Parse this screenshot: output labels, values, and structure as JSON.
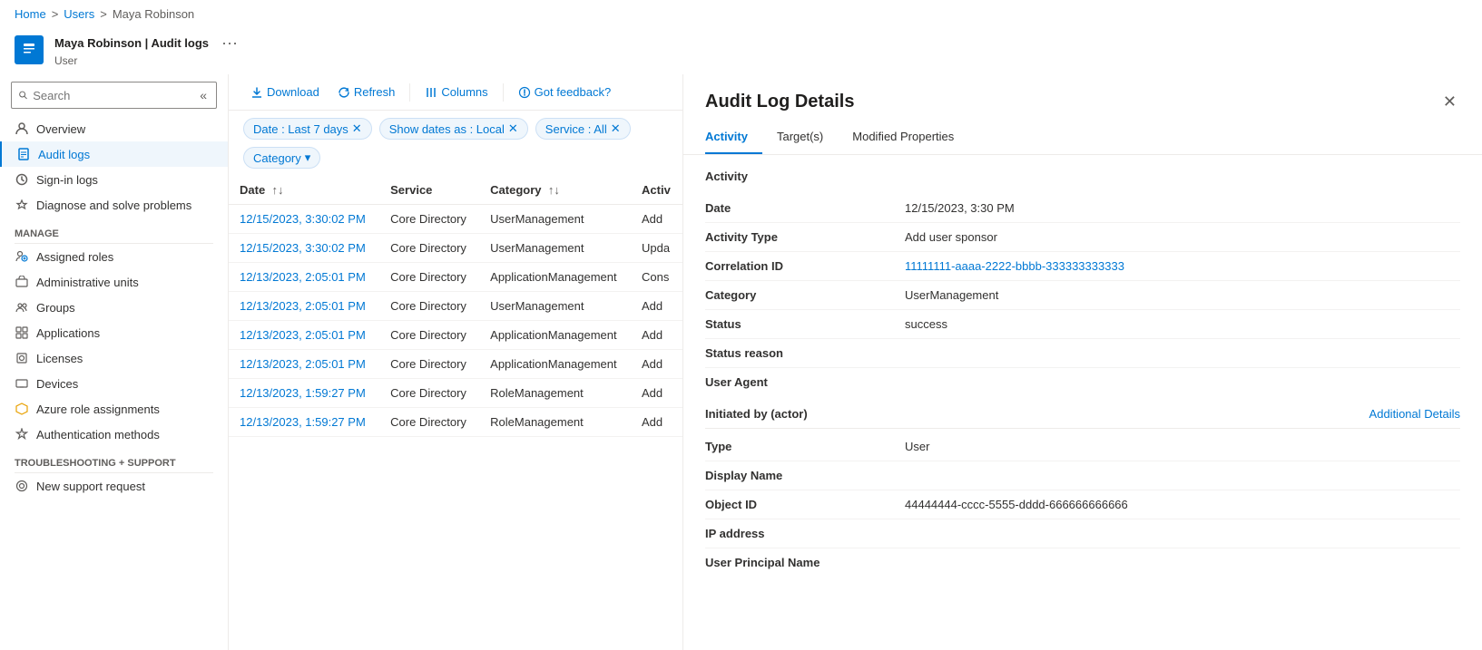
{
  "breadcrumb": {
    "items": [
      "Home",
      "Users",
      "Maya Robinson"
    ],
    "separators": [
      ">",
      ">"
    ]
  },
  "header": {
    "title": "Maya Robinson | Audit logs",
    "subtitle": "User",
    "more_label": "···"
  },
  "sidebar": {
    "search_placeholder": "Search",
    "collapse_icon": "«",
    "nav_items": [
      {
        "id": "overview",
        "label": "Overview",
        "active": false
      },
      {
        "id": "audit-logs",
        "label": "Audit logs",
        "active": true
      },
      {
        "id": "sign-in-logs",
        "label": "Sign-in logs",
        "active": false
      },
      {
        "id": "diagnose",
        "label": "Diagnose and solve problems",
        "active": false
      }
    ],
    "manage_label": "Manage",
    "manage_items": [
      {
        "id": "assigned-roles",
        "label": "Assigned roles"
      },
      {
        "id": "admin-units",
        "label": "Administrative units"
      },
      {
        "id": "groups",
        "label": "Groups"
      },
      {
        "id": "applications",
        "label": "Applications"
      },
      {
        "id": "licenses",
        "label": "Licenses"
      },
      {
        "id": "devices",
        "label": "Devices"
      },
      {
        "id": "azure-roles",
        "label": "Azure role assignments"
      },
      {
        "id": "auth-methods",
        "label": "Authentication methods"
      }
    ],
    "troubleshooting_label": "Troubleshooting + Support",
    "troubleshooting_items": [
      {
        "id": "new-support",
        "label": "New support request"
      }
    ]
  },
  "toolbar": {
    "download_label": "Download",
    "refresh_label": "Refresh",
    "columns_label": "Columns",
    "feedback_label": "Got feedback?"
  },
  "filters": {
    "date_filter": "Date : Last 7 days",
    "dates_as_filter": "Show dates as : Local",
    "service_filter": "Service : All",
    "category_filter": "Category"
  },
  "table": {
    "columns": [
      "Date",
      "Service",
      "Category",
      "Activ"
    ],
    "rows": [
      {
        "date": "12/15/2023, 3:30:02 PM",
        "service": "Core Directory",
        "category": "UserManagement",
        "activity": "Add"
      },
      {
        "date": "12/15/2023, 3:30:02 PM",
        "service": "Core Directory",
        "category": "UserManagement",
        "activity": "Upda"
      },
      {
        "date": "12/13/2023, 2:05:01 PM",
        "service": "Core Directory",
        "category": "ApplicationManagement",
        "activity": "Cons"
      },
      {
        "date": "12/13/2023, 2:05:01 PM",
        "service": "Core Directory",
        "category": "UserManagement",
        "activity": "Add"
      },
      {
        "date": "12/13/2023, 2:05:01 PM",
        "service": "Core Directory",
        "category": "ApplicationManagement",
        "activity": "Add"
      },
      {
        "date": "12/13/2023, 2:05:01 PM",
        "service": "Core Directory",
        "category": "ApplicationManagement",
        "activity": "Add"
      },
      {
        "date": "12/13/2023, 1:59:27 PM",
        "service": "Core Directory",
        "category": "RoleManagement",
        "activity": "Add"
      },
      {
        "date": "12/13/2023, 1:59:27 PM",
        "service": "Core Directory",
        "category": "RoleManagement",
        "activity": "Add"
      }
    ]
  },
  "detail_panel": {
    "title": "Audit Log Details",
    "close_icon": "✕",
    "tabs": [
      {
        "id": "activity",
        "label": "Activity",
        "active": true
      },
      {
        "id": "targets",
        "label": "Target(s)",
        "active": false
      },
      {
        "id": "modified-properties",
        "label": "Modified Properties",
        "active": false
      }
    ],
    "activity_section_label": "Activity",
    "fields": [
      {
        "label": "Date",
        "value": "12/15/2023, 3:30 PM",
        "type": "text"
      },
      {
        "label": "Activity Type",
        "value": "Add user sponsor",
        "type": "text"
      },
      {
        "label": "Correlation ID",
        "value": "11111111-aaaa-2222-bbbb-333333333333",
        "type": "link"
      },
      {
        "label": "Category",
        "value": "UserManagement",
        "type": "text"
      },
      {
        "label": "Status",
        "value": "success",
        "type": "text"
      },
      {
        "label": "Status reason",
        "value": "",
        "type": "text"
      },
      {
        "label": "User Agent",
        "value": "",
        "type": "text"
      }
    ],
    "actor_section_label": "Initiated by (actor)",
    "additional_details_label": "Additional Details",
    "actor_fields": [
      {
        "label": "Type",
        "value": "User",
        "type": "text"
      },
      {
        "label": "Display Name",
        "value": "",
        "type": "text"
      },
      {
        "label": "Object ID",
        "value": "44444444-cccc-5555-dddd-666666666666",
        "type": "text"
      },
      {
        "label": "IP address",
        "value": "",
        "type": "text"
      },
      {
        "label": "User Principal Name",
        "value": "",
        "type": "text"
      }
    ]
  }
}
